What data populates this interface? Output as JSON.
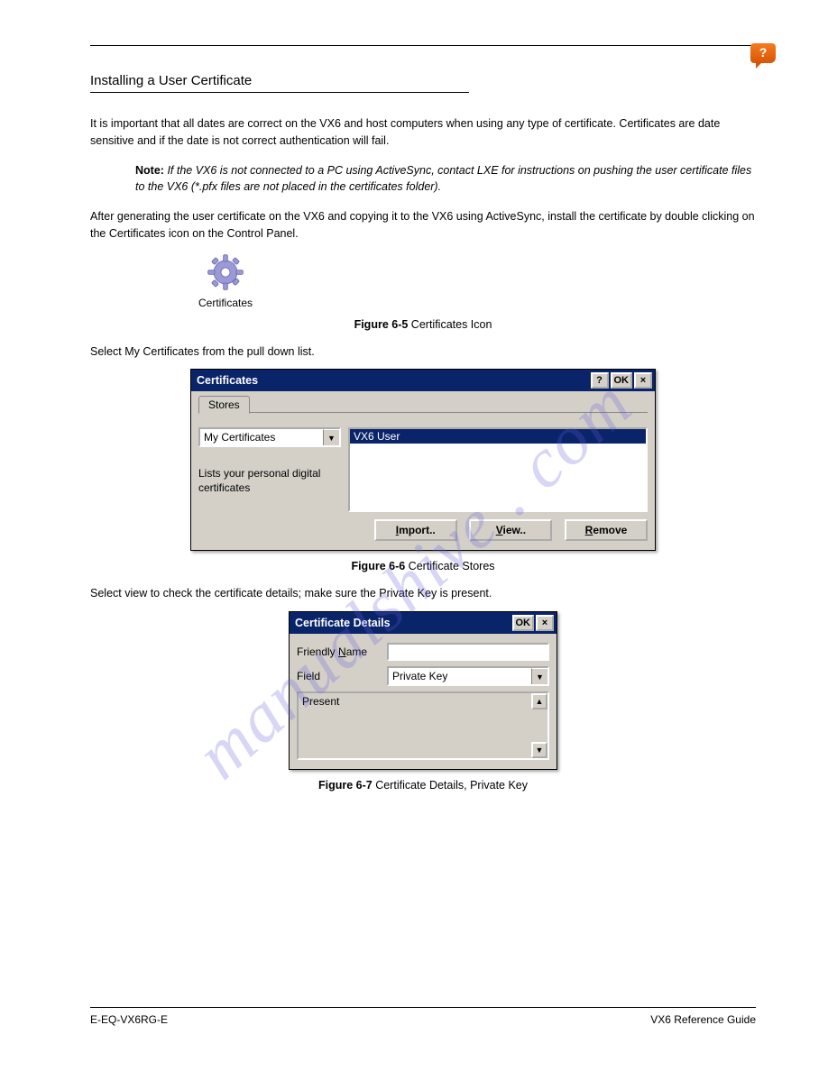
{
  "helpGlyph": "?",
  "sectionTitle": "Installing a User Certificate",
  "caption1": {
    "prefix": "Figure 6-5 ",
    "text": "Certificates Icon"
  },
  "intro1": "It is important that all dates are correct on the VX6 and host computers when using any type of certificate. Certificates are date sensitive and if the date is not correct authentication will fail.",
  "note": {
    "label": "Note:",
    "text": "If the VX6 is not connected to a PC using ActiveSync, contact LXE for instructions on pushing the user certificate files to the VX6 (*.pfx files are not placed in the certificates folder)."
  },
  "intro2": "After generating the user certificate on the VX6 and copying it to the VX6 using ActiveSync, install the certificate by double clicking on the Certificates icon on the Control Panel.",
  "intro3": "Select My Certificates from the pull down list.",
  "dialog1": {
    "title": "Certificates",
    "tab": "Stores",
    "dropdown": "My Certificates",
    "desc": "Lists your personal digital certificates",
    "listItem": "VX6 User",
    "btnImport": {
      "u": "I",
      "rest": "mport.."
    },
    "btnView": {
      "u": "V",
      "rest": "iew.."
    },
    "btnRemove": {
      "u": "R",
      "rest": "emove"
    },
    "help": "?",
    "ok": "OK",
    "x": "×"
  },
  "caption2": {
    "prefix": "Figure 6-6 ",
    "text": "Certificate Stores"
  },
  "intro4": "Select view to check the certificate details; make sure the Private Key is present.",
  "dialog2": {
    "title": "Certificate Details",
    "ok": "OK",
    "x": "×",
    "friendly": {
      "pre": "Friendly ",
      "u": "N",
      "post": "ame"
    },
    "fieldLabel": "Field",
    "fieldValue": "Private Key",
    "memo": "Present"
  },
  "caption3": {
    "prefix": "Figure 6-7 ",
    "text": "Certificate Details, Private Key"
  },
  "certIconLabel": "Certificates",
  "watermark": "manualshive . com",
  "footer": {
    "left": "E-EQ-VX6RG-E",
    "right": "VX6 Reference Guide"
  }
}
